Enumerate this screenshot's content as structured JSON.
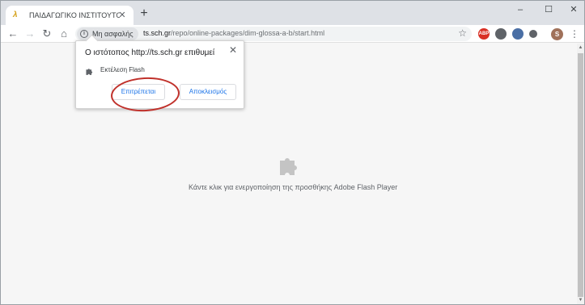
{
  "browser": {
    "tab": {
      "title": "ΠΑΙΔΑΓΩΓΙΚΟ ΙΝΣΤΙΤΟΥΤΟ - ΓΛΩ",
      "favicon": "pi-logo-icon",
      "close_glyph": "✕"
    },
    "new_tab_glyph": "+",
    "window_controls": {
      "minimize": "–",
      "maximize": "☐",
      "close": "✕"
    },
    "toolbar": {
      "back_glyph": "←",
      "forward_glyph": "→",
      "reload_glyph": "↻",
      "home_glyph": "⌂",
      "security_label": "Μη ασφαλής",
      "url_host": "ts.sch.gr",
      "url_path": "/repo/online-packages/dim-glossa-a-b/start.html",
      "star_glyph": "☆",
      "menu_glyph": "⋮"
    },
    "extensions": [
      {
        "name": "adblock-icon",
        "label": "ABP",
        "color": "#d93025"
      },
      {
        "name": "extension-icon-2",
        "label": "",
        "color": "#5f6368"
      },
      {
        "name": "extension-icon-3",
        "label": "",
        "color": "#4a6fa5"
      },
      {
        "name": "extension-icon-4",
        "label": "",
        "color": "#5f6368"
      }
    ],
    "profile": {
      "initial": "S",
      "color": "#a0715a"
    }
  },
  "page": {
    "plugin_message": "Κάντε κλικ για ενεργοποίηση της προσθήκης Adobe Flash Player",
    "plugin_icon": "puzzle-piece-icon"
  },
  "flash_prompt": {
    "title": "Ο ιστότοπος http://ts.sch.gr επιθυμεί",
    "permission_label": "Εκτέλεση Flash",
    "allow_label": "Επιτρέπεται",
    "block_label": "Αποκλεισμός",
    "close_glyph": "✕"
  },
  "colors": {
    "accent": "#1a73e8",
    "annotation": "#c0312b"
  }
}
